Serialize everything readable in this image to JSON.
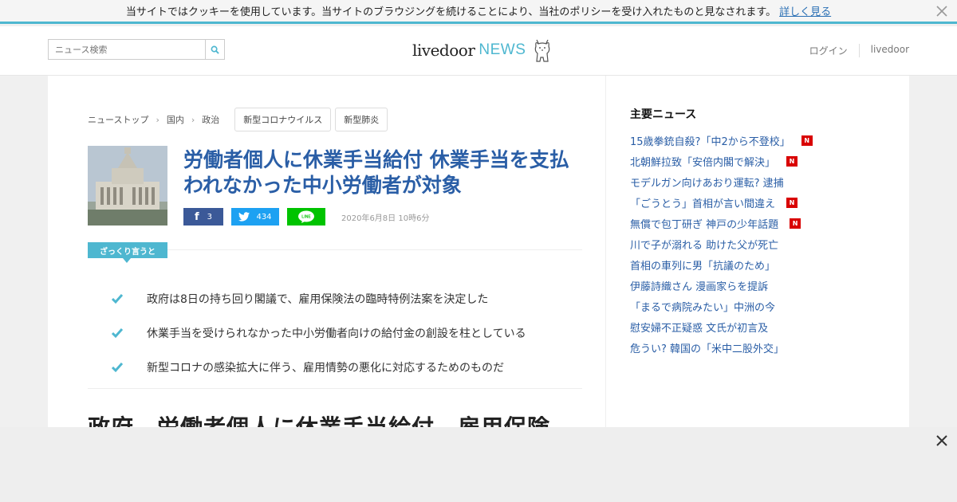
{
  "cookie": {
    "text": "当サイトではクッキーを使用しています。当サイトのブラウジングを続けることにより、当社のポリシーを受け入れたものと見なされます。",
    "link": "詳しく見る"
  },
  "header": {
    "search_placeholder": "ニュース検索",
    "logo_main": "livedoor",
    "logo_news": "NEWS",
    "login": "ログイン",
    "livedoor": "livedoor"
  },
  "breadcrumbs": [
    "ニューストップ",
    "国内",
    "政治"
  ],
  "tags": [
    "新型コロナウイルス",
    "新型肺炎"
  ],
  "article": {
    "title": "労働者個人に休業手当給付 休業手当を支払われなかった中小労働者が対象",
    "fb_count": "3",
    "tw_count": "434",
    "date": "2020年6月8日 10時6分",
    "summary_label": "ざっくり言うと",
    "summary": [
      "政府は8日の持ち回り閣議で、雇用保険法の臨時特例法案を決定した",
      "休業手当を受けられなかった中小労働者向けの給付金の創設を柱としている",
      "新型コロナの感染拡大に伴う、雇用情勢の悪化に対応するためのものだ"
    ],
    "body_heading": "政府、労働者個人に休業手当給付　雇用保険"
  },
  "sidebar": {
    "title": "主要ニュース",
    "items": [
      {
        "text": "15歳拳銃自殺?「中2から不登校」",
        "new": true
      },
      {
        "text": "北朝鮮拉致「安倍内閣で解決」",
        "new": true
      },
      {
        "text": "モデルガン向けあおり運転? 逮捕",
        "new": false
      },
      {
        "text": "「ごうとう」首相が言い間違え",
        "new": true
      },
      {
        "text": "無償で包丁研ぎ 神戸の少年話題",
        "new": true
      },
      {
        "text": "川で子が溺れる 助けた父が死亡",
        "new": false
      },
      {
        "text": "首相の車列に男「抗議のため」",
        "new": false
      },
      {
        "text": "伊藤詩織さん 漫画家らを提訴",
        "new": false
      },
      {
        "text": "「まるで病院みたい」中洲の今",
        "new": false
      },
      {
        "text": "慰安婦不正疑惑 文氏が初言及",
        "new": false
      },
      {
        "text": "危うい? 韓国の「米中二股外交」",
        "new": false
      }
    ],
    "new_badge": "N"
  },
  "colors": {
    "accent": "#4eb7d0",
    "link": "#2a5ea6",
    "facebook": "#3b5998",
    "twitter": "#1da1f2",
    "line": "#00c300",
    "new_badge": "#d90000"
  }
}
